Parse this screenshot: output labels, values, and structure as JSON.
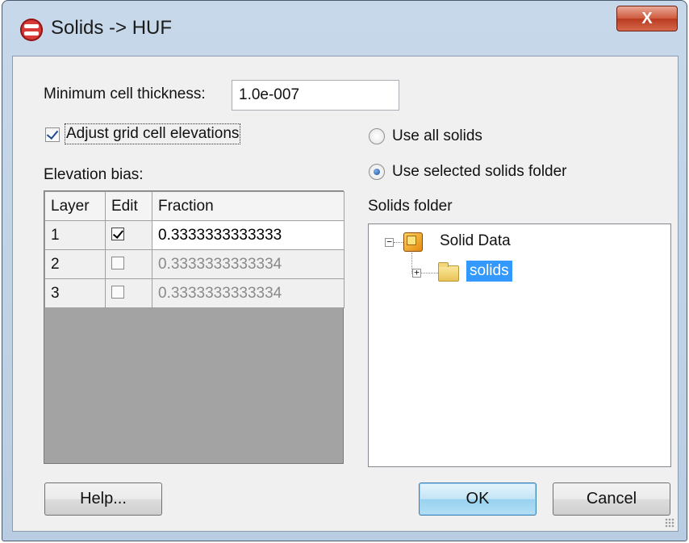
{
  "window": {
    "title": "Solids -> HUF",
    "close_label": "X"
  },
  "min_cell": {
    "label": "Minimum cell thickness:",
    "value": "1.0e-007"
  },
  "adjust": {
    "label": "Adjust grid cell elevations",
    "checked": true
  },
  "elevation_bias": {
    "label": "Elevation bias:",
    "columns": [
      "Layer",
      "Edit",
      "Fraction"
    ],
    "rows": [
      {
        "layer": "1",
        "edit": true,
        "fraction": "0.3333333333333"
      },
      {
        "layer": "2",
        "edit": false,
        "fraction": "0.3333333333334"
      },
      {
        "layer": "3",
        "edit": false,
        "fraction": "0.3333333333334"
      }
    ]
  },
  "solid_options": {
    "use_all": "Use all solids",
    "use_selected": "Use selected solids folder",
    "selected": "use_selected"
  },
  "folder": {
    "label": "Solids folder",
    "root": "Solid Data",
    "child": "solids",
    "root_icon": "cube-icon",
    "child_icon": "folder-icon"
  },
  "buttons": {
    "help": "Help...",
    "ok": "OK",
    "cancel": "Cancel"
  },
  "colors": {
    "selection": "#3399ff",
    "grid_empty": "#a3a3a3"
  }
}
